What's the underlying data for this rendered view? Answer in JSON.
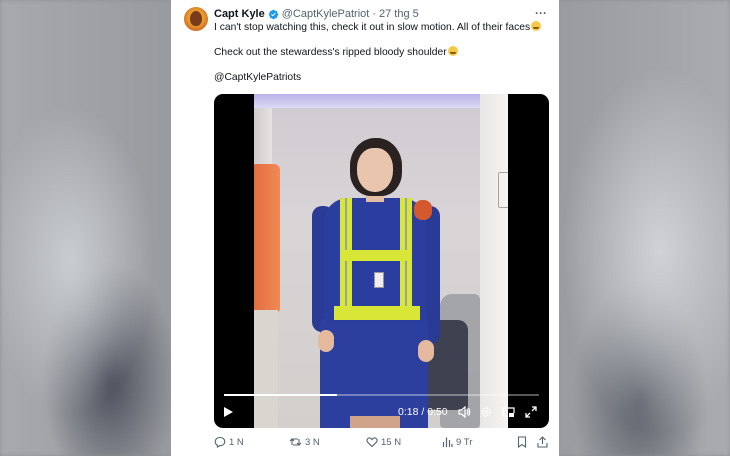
{
  "tweet": {
    "author_name": "Capt Kyle",
    "handle": "@CaptKylePatriot",
    "separator": "·",
    "date": "27 thg 5",
    "more_label": "···",
    "line1": "I can't stop watching this, check it out in slow motion. All of their faces",
    "line2": "Check out the stewardess's ripped bloody shoulder",
    "line3": "@CaptKylePatriots"
  },
  "video": {
    "time_display": "0:18 / 0:50",
    "progress_fraction": 0.36
  },
  "actions": {
    "replies": "1 N",
    "retweets": "3 N",
    "likes": "15 N",
    "views": "9 Tr"
  },
  "colors": {
    "text_primary": "#0f1419",
    "text_secondary": "#536471",
    "verified_blue": "#1d9bf0"
  }
}
